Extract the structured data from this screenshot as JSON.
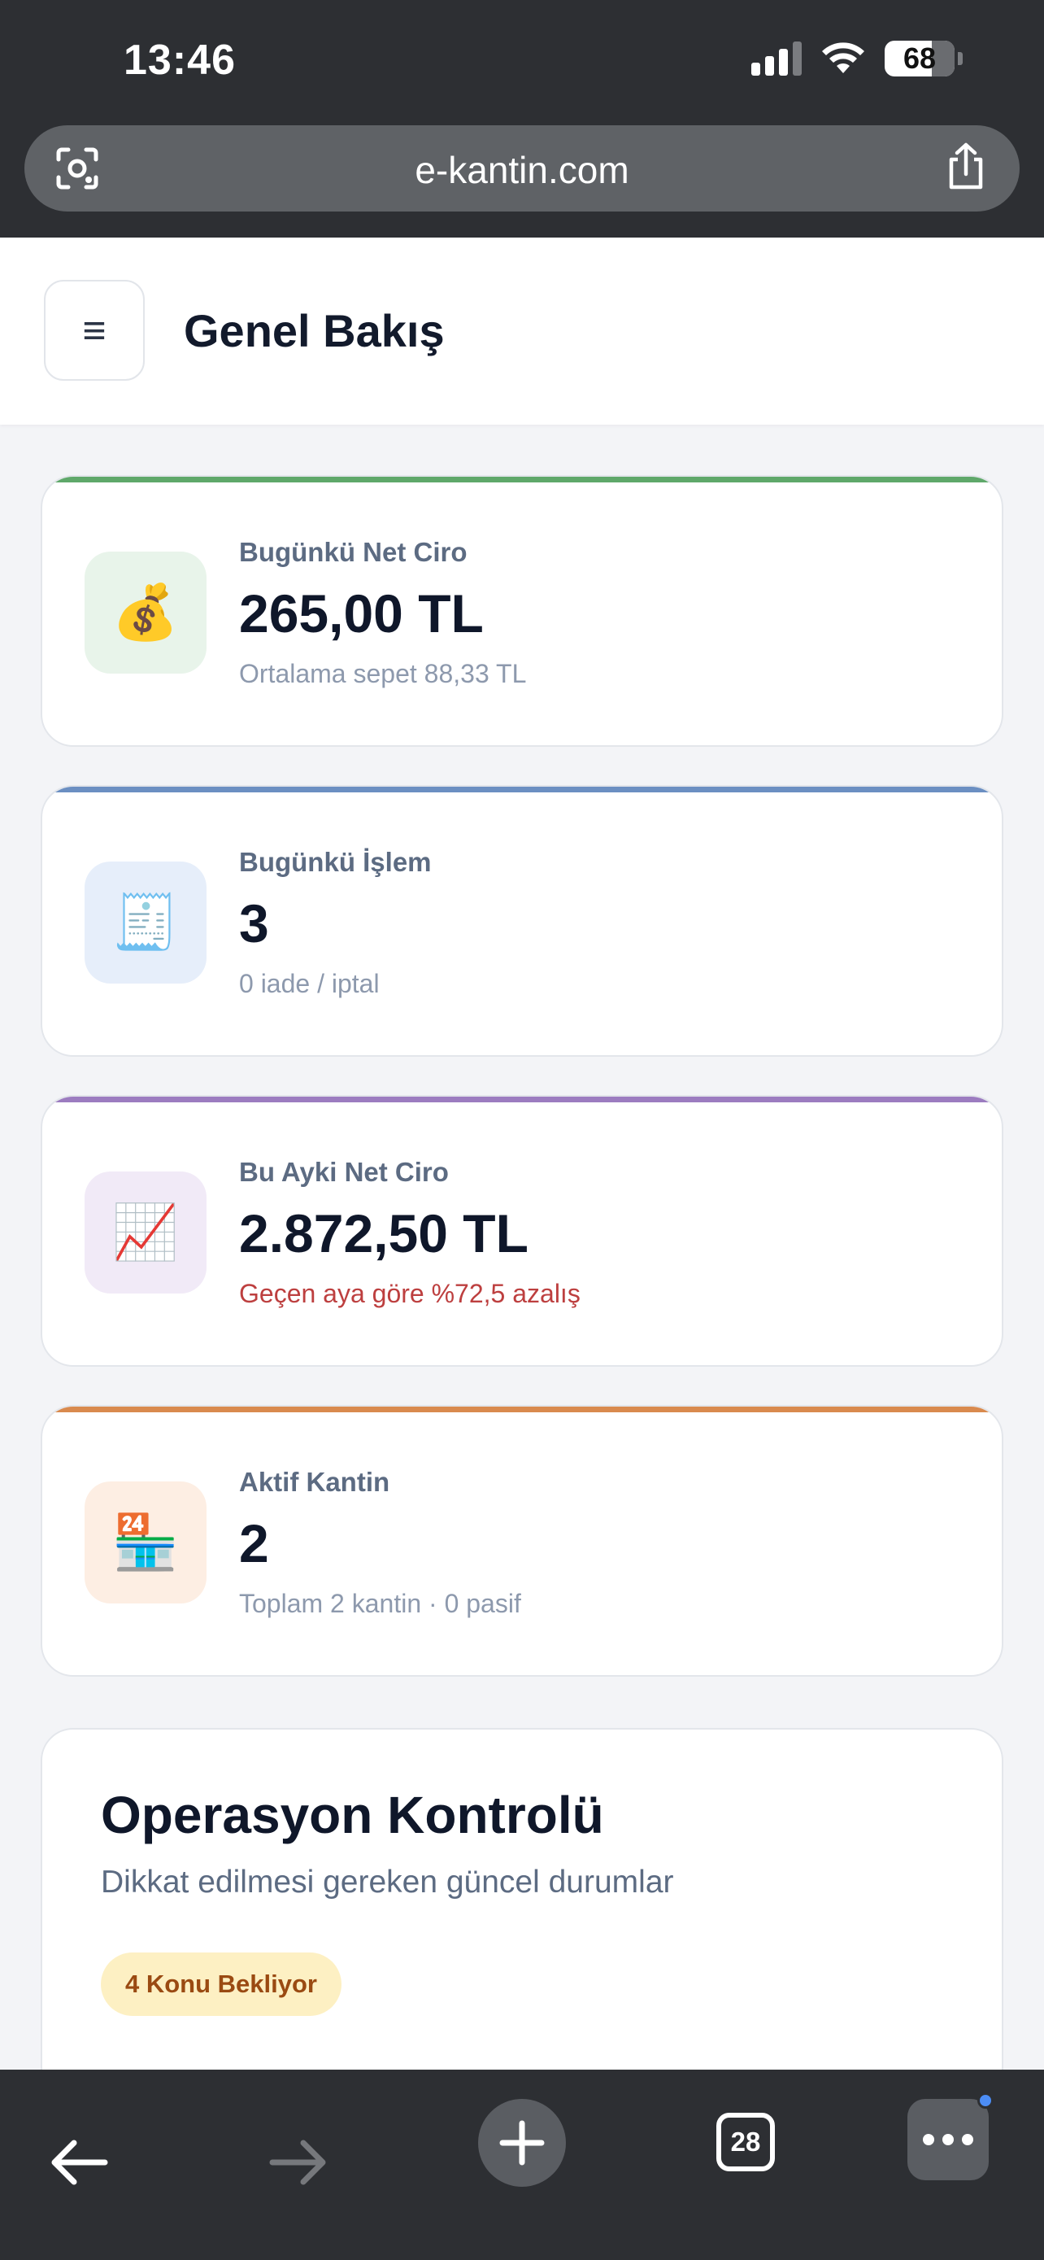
{
  "status_bar": {
    "time": "13:46",
    "battery": "68"
  },
  "browser": {
    "url": "e-kantin.com",
    "tab_count": "28"
  },
  "header": {
    "menu_icon": "≡",
    "title": "Genel Bakış"
  },
  "cards": [
    {
      "label": "Bugünkü Net Ciro",
      "value": "265,00 TL",
      "sub": "Ortalama sepet 88,33 TL",
      "emoji": "💰",
      "accent": "#5fa86a",
      "tint": "#e8f4ea"
    },
    {
      "label": "Bugünkü İşlem",
      "value": "3",
      "sub": "0 iade / iptal",
      "emoji": "🧾",
      "accent": "#6b8fc2",
      "tint": "#e6eefa"
    },
    {
      "label": "Bu Ayki Net Ciro",
      "value": "2.872,50 TL",
      "sub": "Geçen aya göre %72,5 azalış",
      "emoji": "📈",
      "accent": "#9c7cc0",
      "tint": "#f1eaf7"
    },
    {
      "label": "Aktif Kantin",
      "value": "2",
      "sub": "Toplam 2 kantin · 0 pasif",
      "emoji": "🏪",
      "accent": "#d98a4e",
      "tint": "#fdeee3"
    }
  ],
  "operations": {
    "title": "Operasyon Kontrolü",
    "subtitle": "Dikkat edilmesi gereken güncel durumlar",
    "badge": "4 Konu Bekliyor"
  },
  "colors": {
    "negative": "#bd3f3f",
    "badge_bg": "#fdf0c3",
    "badge_text": "#9a4a12"
  }
}
